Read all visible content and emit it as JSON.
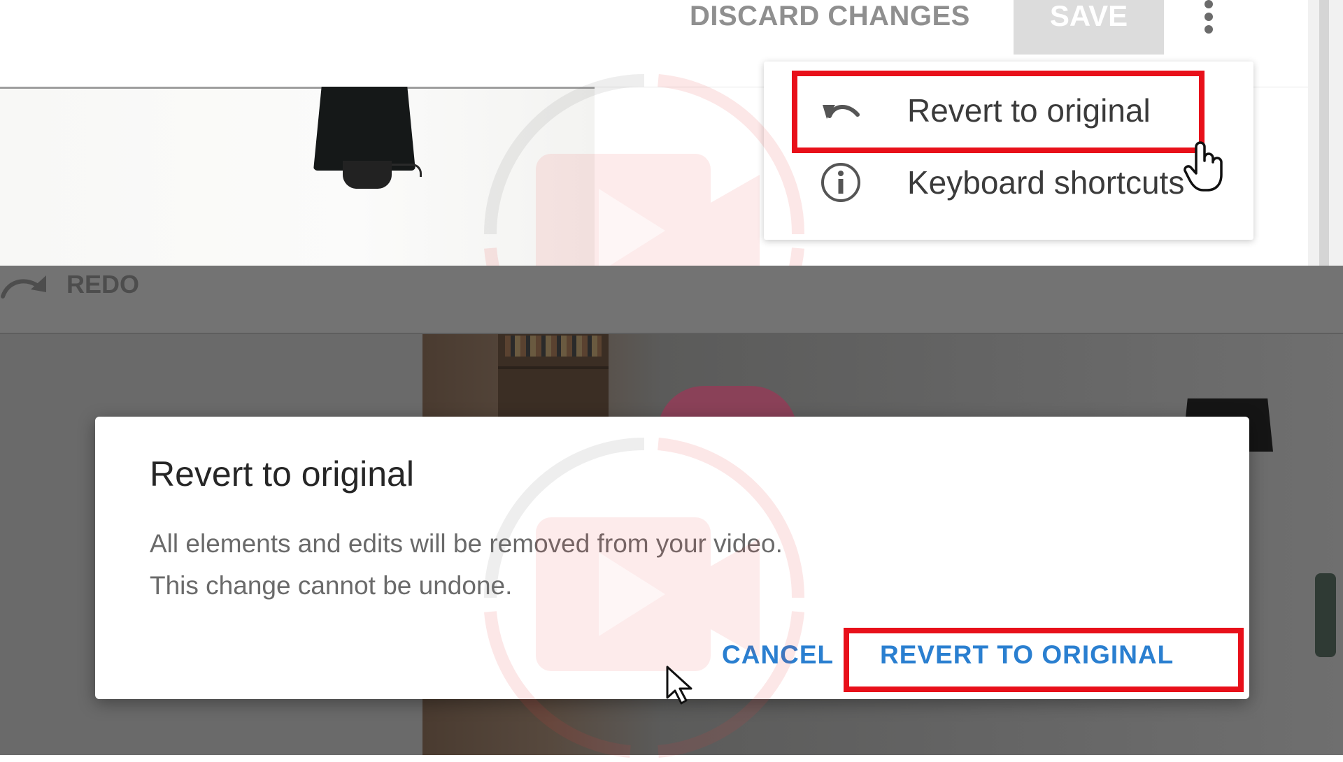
{
  "header": {
    "discard_label": "DISCARD CHANGES",
    "save_label": "SAVE"
  },
  "more_menu": {
    "items": [
      {
        "icon": "undo-icon",
        "label": "Revert to original"
      },
      {
        "icon": "info-icon",
        "label": "Keyboard shortcuts"
      }
    ]
  },
  "toolbar": {
    "redo_label": "REDO"
  },
  "dialog": {
    "title": "Revert to original",
    "body_line_1": "All elements and edits will be removed from your video.",
    "body_line_2": "This change cannot be undone.",
    "cancel_label": "CANCEL",
    "confirm_label": "REVERT TO ORIGINAL"
  },
  "colors": {
    "highlight": "#e8101a",
    "dialog_button": "#2a7fd0",
    "disabled_button": "#dcdcdc"
  }
}
